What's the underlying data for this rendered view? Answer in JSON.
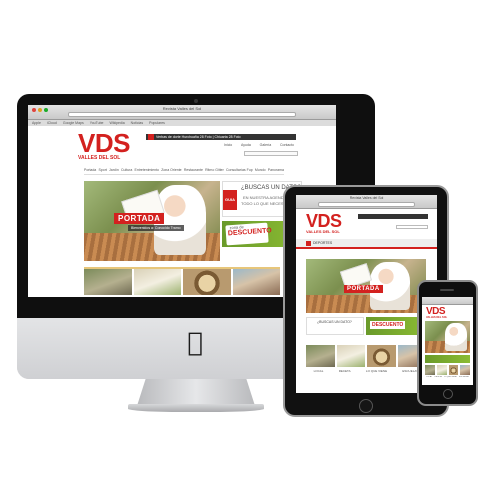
{
  "desktop": {
    "browser_title": "Revista Valles del Sol",
    "bookmarks": [
      "Apple",
      "iCloud",
      "Google Maps",
      "YouTube",
      "Wikipedia",
      "Noticias",
      "Populares"
    ],
    "logo_main": "VDS",
    "logo_sub": "VALLES DEL SOL",
    "date_line": "Verbas de dorte Hurchuaña 28 Foto | Chiuarta 28 Foto",
    "top_links": [
      "Inicio",
      "Ayuda",
      "Galería",
      "Contacto"
    ],
    "menu": [
      "Portada",
      "Sport",
      "Jardín",
      "Cultura",
      "Entretenimiento",
      "Zona Oriente",
      "Restaurante",
      "Ritmo Gitter",
      "Consultarías Fup",
      "Mundo",
      "Panorama"
    ],
    "hero_label": "PORTADA",
    "hero_caption": "Bienvenidos a: Conocido Tramo",
    "ad_buscas_title": "¿BUSCAS UN DATO?",
    "ad_buscas_line1": "EN NUESTRA AGENDA",
    "ad_buscas_line2": "TODO LO QUE NECESITAS EN",
    "ad_guia": "GUIA",
    "ad_descuento_pre": "zona de",
    "ad_descuento": "DESCUENTO"
  },
  "tablet": {
    "browser_title": "Revista Valles del Sol",
    "logo_main": "VDS",
    "logo_sub": "VALLES DEL SOL",
    "section": "DEPORTES",
    "hero_label": "PORTADA",
    "ad_buscas_title": "¿BUSCAS UN DATO?",
    "ad_descuento": "DESCUENTO",
    "row_labels": [
      "LOCAL",
      "RECETA",
      "LO QUE VIENE",
      "ESCUELAS"
    ]
  },
  "phone": {
    "logo_main": "VDS",
    "logo_sub": "VALLES DEL SOL",
    "row_labels": [
      "LOCAL",
      "RECETA",
      "LO QUE VIENE",
      "ESCUELAS"
    ]
  },
  "colors": {
    "brand_red": "#d3211f",
    "ad_green": "#7aaa2e",
    "device_black": "#111111",
    "aluminum": "#d9dadc"
  },
  "icons": {
    "apple_logo": "apple-logo-icon",
    "home_button": "home-button-icon"
  }
}
